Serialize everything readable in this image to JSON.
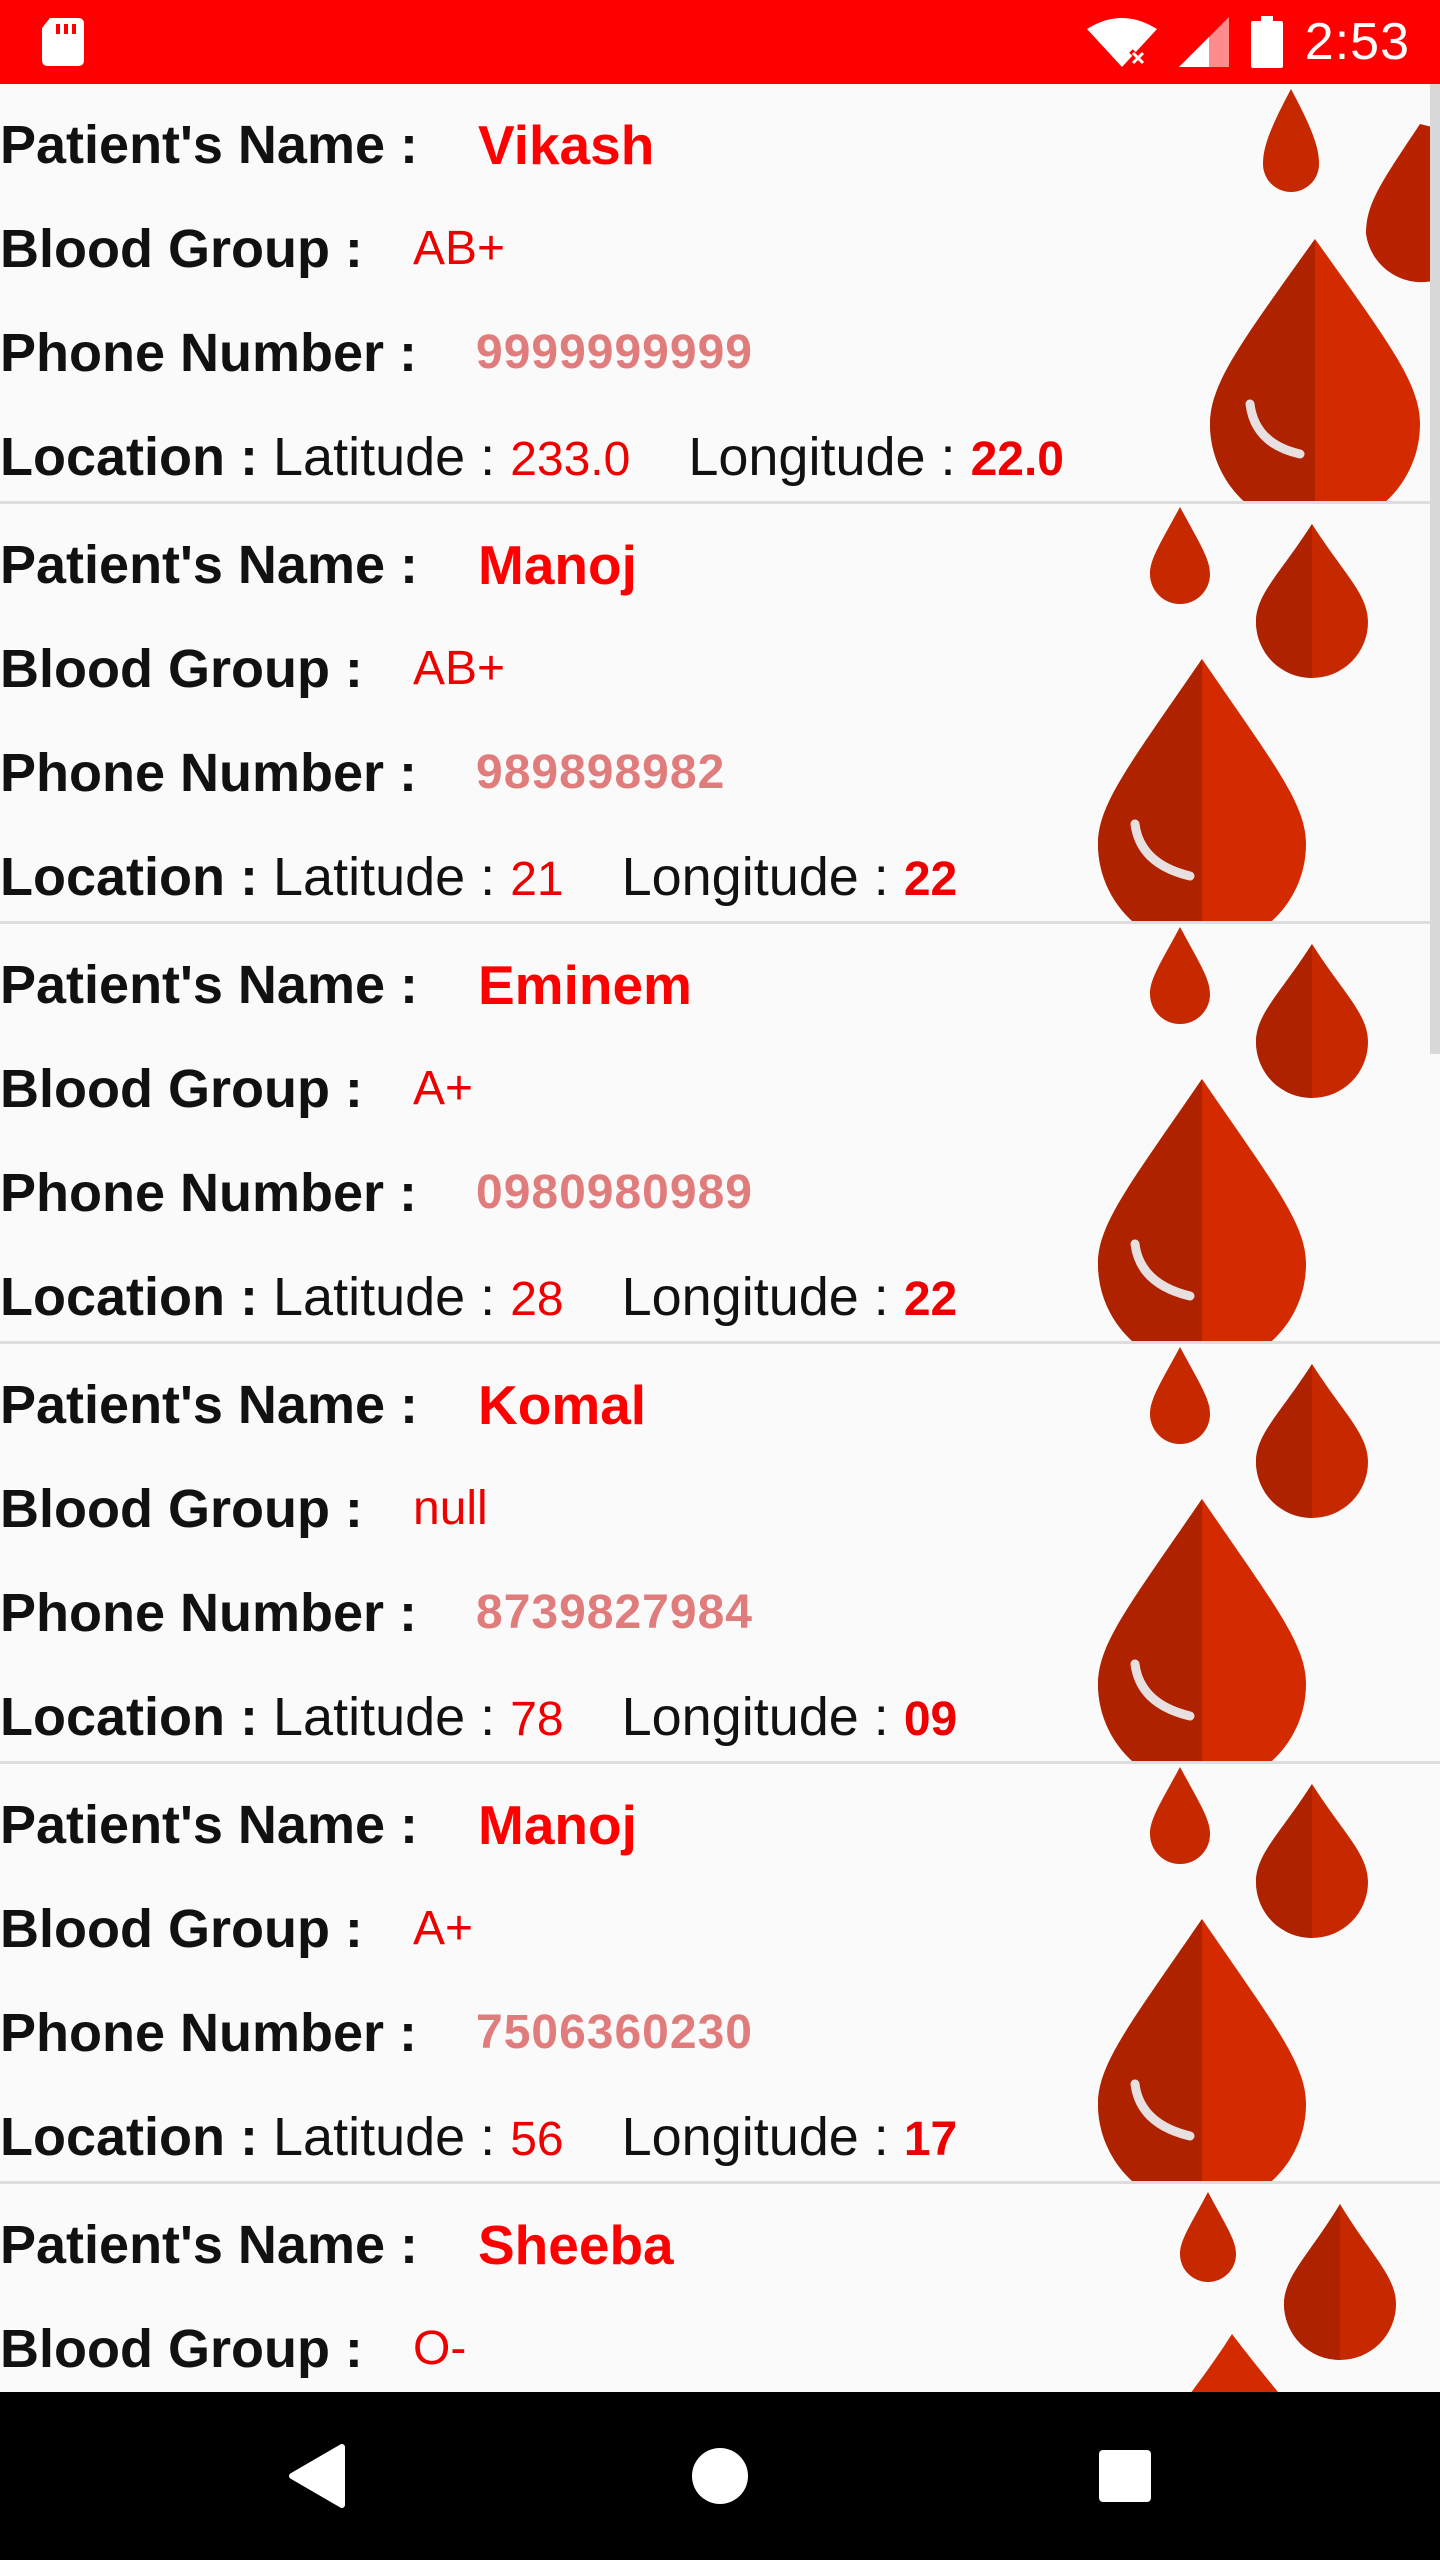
{
  "status_bar": {
    "time": "2:53",
    "icons": [
      "sd-card-icon",
      "wifi-off-icon",
      "signal-icon",
      "battery-icon"
    ]
  },
  "labels": {
    "name": "Patient's Name :",
    "blood": "Blood Group :",
    "phone": "Phone Number :",
    "location": "Location :",
    "latitude": "Latitude :",
    "longitude": "Longitude :"
  },
  "patients": [
    {
      "name": "Vikash",
      "blood": "AB+",
      "phone": "9999999999",
      "lat": "233.0",
      "lon": "22.0"
    },
    {
      "name": "Manoj",
      "blood": "AB+",
      "phone": "989898982",
      "lat": "21",
      "lon": "22"
    },
    {
      "name": "Eminem",
      "blood": "A+",
      "phone": "0980980989",
      "lat": "28",
      "lon": "22"
    },
    {
      "name": "Komal",
      "blood": "null",
      "phone": "8739827984",
      "lat": "78",
      "lon": "09"
    },
    {
      "name": "Manoj",
      "blood": "A+",
      "phone": "7506360230",
      "lat": "56",
      "lon": "17"
    },
    {
      "name": "Sheeba",
      "blood": "O-",
      "phone": "",
      "lat": "",
      "lon": ""
    }
  ],
  "nav": {
    "icons": [
      "back-icon",
      "home-icon",
      "recents-icon"
    ]
  },
  "colors": {
    "status_bar": "#ff0000",
    "accent_red": "#ff0000",
    "phone_pink": "#e07c7c",
    "drop_red": "#d42a00"
  }
}
